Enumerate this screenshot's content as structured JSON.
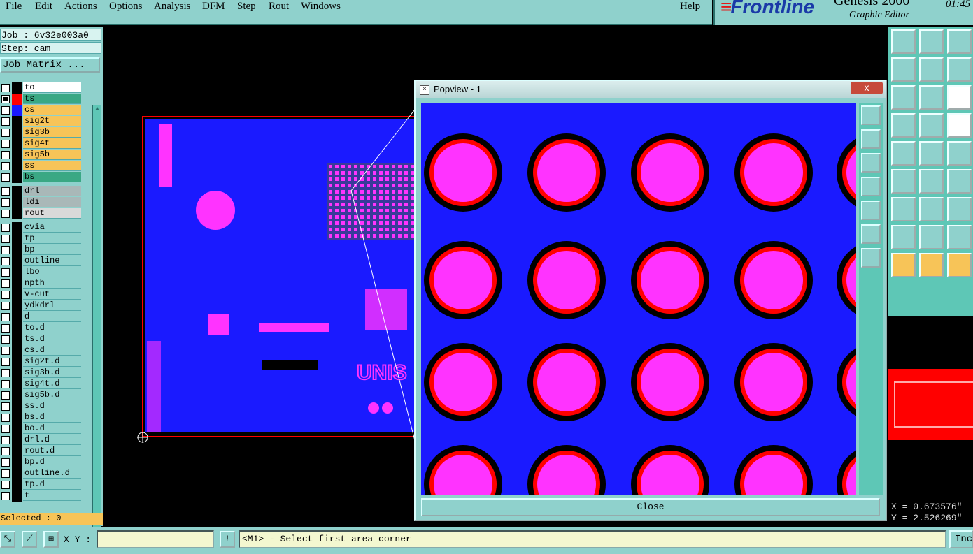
{
  "menu": {
    "items": [
      "File",
      "Edit",
      "Actions",
      "Options",
      "Analysis",
      "DFM",
      "Step",
      "Rout",
      "Windows"
    ],
    "help": "Help"
  },
  "brand": {
    "logo": "Frontline",
    "product": "Genesis 2000",
    "subtitle": "Graphic Editor",
    "time": "01:45"
  },
  "job": {
    "job_label": "Job : 6v32e003a0",
    "step_label": "Step: cam",
    "matrix_button": "Job Matrix ..."
  },
  "layers": [
    {
      "name": "to",
      "bg": "#ffffff",
      "swatch": "#000000",
      "checked": false
    },
    {
      "name": "ts",
      "bg": "#3aa884",
      "swatch": "#ff0000",
      "checked": true
    },
    {
      "name": "cs",
      "bg": "#f7c458",
      "swatch": "#1a1aff",
      "checked": false
    },
    {
      "name": "sig2t",
      "bg": "#f7c458",
      "swatch": "#000000",
      "checked": false
    },
    {
      "name": "sig3b",
      "bg": "#f7c458",
      "swatch": "#000000",
      "checked": false
    },
    {
      "name": "sig4t",
      "bg": "#f7c458",
      "swatch": "#000000",
      "checked": false
    },
    {
      "name": "sig5b",
      "bg": "#f7c458",
      "swatch": "#000000",
      "checked": false
    },
    {
      "name": "ss",
      "bg": "#f7c458",
      "swatch": "#000000",
      "checked": false
    },
    {
      "name": "bs",
      "bg": "#3aa884",
      "swatch": "#000000",
      "checked": false
    },
    {
      "name": "drl",
      "bg": "#a9b8b8",
      "swatch": "#000000",
      "checked": false
    },
    {
      "name": "ldi",
      "bg": "#a9b8b8",
      "swatch": "#000000",
      "checked": false
    },
    {
      "name": "rout",
      "bg": "#d9d9d9",
      "swatch": "#000000",
      "checked": false
    },
    {
      "name": "cvia",
      "bg": "#8fd1cc",
      "swatch": "#000000",
      "checked": false
    },
    {
      "name": "tp",
      "bg": "#8fd1cc",
      "swatch": "#000000",
      "checked": false
    },
    {
      "name": "bp",
      "bg": "#8fd1cc",
      "swatch": "#000000",
      "checked": false
    },
    {
      "name": "outline",
      "bg": "#8fd1cc",
      "swatch": "#000000",
      "checked": false
    },
    {
      "name": "lbo",
      "bg": "#8fd1cc",
      "swatch": "#000000",
      "checked": false
    },
    {
      "name": "npth",
      "bg": "#8fd1cc",
      "swatch": "#000000",
      "checked": false
    },
    {
      "name": "v-cut",
      "bg": "#8fd1cc",
      "swatch": "#000000",
      "checked": false
    },
    {
      "name": "ydkdrl",
      "bg": "#8fd1cc",
      "swatch": "#000000",
      "checked": false
    },
    {
      "name": "d",
      "bg": "#8fd1cc",
      "swatch": "#000000",
      "checked": false
    },
    {
      "name": "to.d",
      "bg": "#8fd1cc",
      "swatch": "#000000",
      "checked": false
    },
    {
      "name": "ts.d",
      "bg": "#8fd1cc",
      "swatch": "#000000",
      "checked": false
    },
    {
      "name": "cs.d",
      "bg": "#8fd1cc",
      "swatch": "#000000",
      "checked": false
    },
    {
      "name": "sig2t.d",
      "bg": "#8fd1cc",
      "swatch": "#000000",
      "checked": false
    },
    {
      "name": "sig3b.d",
      "bg": "#8fd1cc",
      "swatch": "#000000",
      "checked": false
    },
    {
      "name": "sig4t.d",
      "bg": "#8fd1cc",
      "swatch": "#000000",
      "checked": false
    },
    {
      "name": "sig5b.d",
      "bg": "#8fd1cc",
      "swatch": "#000000",
      "checked": false
    },
    {
      "name": "ss.d",
      "bg": "#8fd1cc",
      "swatch": "#000000",
      "checked": false
    },
    {
      "name": "bs.d",
      "bg": "#8fd1cc",
      "swatch": "#000000",
      "checked": false
    },
    {
      "name": "bo.d",
      "bg": "#8fd1cc",
      "swatch": "#000000",
      "checked": false
    },
    {
      "name": "drl.d",
      "bg": "#8fd1cc",
      "swatch": "#000000",
      "checked": false
    },
    {
      "name": "rout.d",
      "bg": "#8fd1cc",
      "swatch": "#000000",
      "checked": false
    },
    {
      "name": "bp.d",
      "bg": "#8fd1cc",
      "swatch": "#000000",
      "checked": false
    },
    {
      "name": "outline.d",
      "bg": "#8fd1cc",
      "swatch": "#000000",
      "checked": false
    },
    {
      "name": "tp.d",
      "bg": "#8fd1cc",
      "swatch": "#000000",
      "checked": false
    },
    {
      "name": "t",
      "bg": "#8fd1cc",
      "swatch": "#000000",
      "checked": false
    }
  ],
  "status": {
    "selected": "Selected : 0"
  },
  "popview": {
    "title": "Popview - 1",
    "close_x": "x",
    "close_button": "Close"
  },
  "coords": {
    "x": "X = 0.673576\"",
    "y": "Y = 2.526269\""
  },
  "bottombar": {
    "xy_label": "X Y :",
    "xy_value": "",
    "message": "<M1> - Select first area corner",
    "inc_button": "Inc",
    "bang": "!"
  },
  "colors": {
    "panel": "#8fd1cc",
    "copper": "#1a1aff",
    "pad": "#ff33ff",
    "mask": "#ff0000"
  }
}
